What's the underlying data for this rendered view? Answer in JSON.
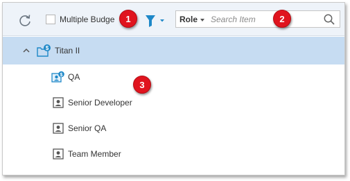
{
  "toolbar": {
    "multiple_budget_label": "Multiple Budge",
    "role_dropdown_label": "Role",
    "search_placeholder": "Search Item"
  },
  "tree": {
    "root": {
      "label": "Titan II",
      "expanded": true
    },
    "children": [
      {
        "label": "QA",
        "icon": "role-budget-icon"
      },
      {
        "label": "Senior Developer",
        "icon": "person-card-icon"
      },
      {
        "label": "Senior QA",
        "icon": "person-card-icon"
      },
      {
        "label": "Team Member",
        "icon": "person-card-icon"
      }
    ]
  },
  "callouts": [
    "1",
    "2",
    "3"
  ],
  "colors": {
    "accent": "#1e88c8",
    "selected_row": "#c6dcf2",
    "badge": "#e0141e",
    "toolbar": "#eef3f9"
  }
}
